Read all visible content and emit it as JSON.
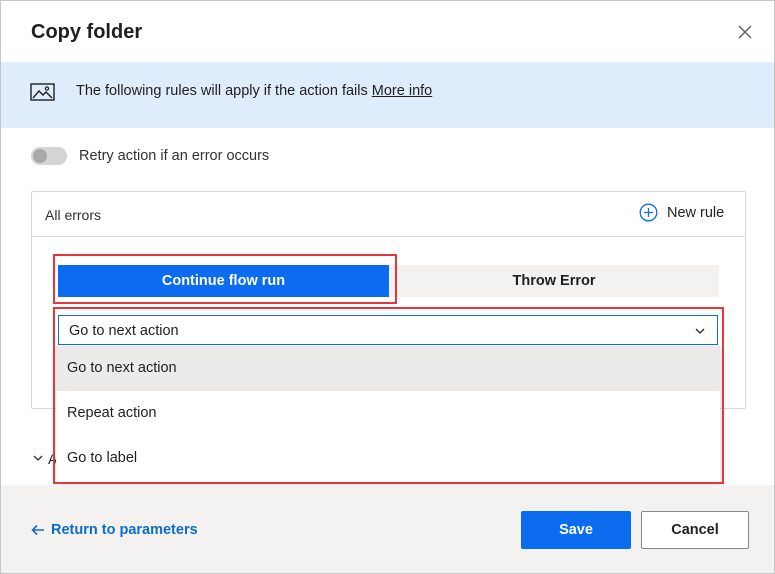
{
  "dialog": {
    "title": "Copy folder"
  },
  "banner": {
    "text": "The following rules will apply if the action fails",
    "link": "More info"
  },
  "retry": {
    "label": "Retry action if an error occurs",
    "enabled": false
  },
  "rules": {
    "header_label": "All errors",
    "new_rule_label": "New rule",
    "tabs": [
      {
        "label": "Continue flow run",
        "selected": true
      },
      {
        "label": "Throw Error",
        "selected": false
      }
    ],
    "select": {
      "value": "Go to next action",
      "options": [
        {
          "label": "Go to next action",
          "selected": true
        },
        {
          "label": "Repeat action",
          "selected": false
        },
        {
          "label": "Go to label",
          "selected": false
        }
      ]
    }
  },
  "advanced": {
    "partial_label": "A"
  },
  "footer": {
    "back_label": "Return to parameters",
    "save_label": "Save",
    "cancel_label": "Cancel"
  },
  "icons": {
    "close": "close-icon",
    "image": "image-icon",
    "add": "add-circle-icon",
    "chevron": "chevron-down-icon",
    "back": "arrow-left-icon"
  },
  "colors": {
    "accent": "#0b6cf0",
    "banner": "#dfecfb",
    "highlight": "#e8343c",
    "link": "#0b6cc9"
  }
}
